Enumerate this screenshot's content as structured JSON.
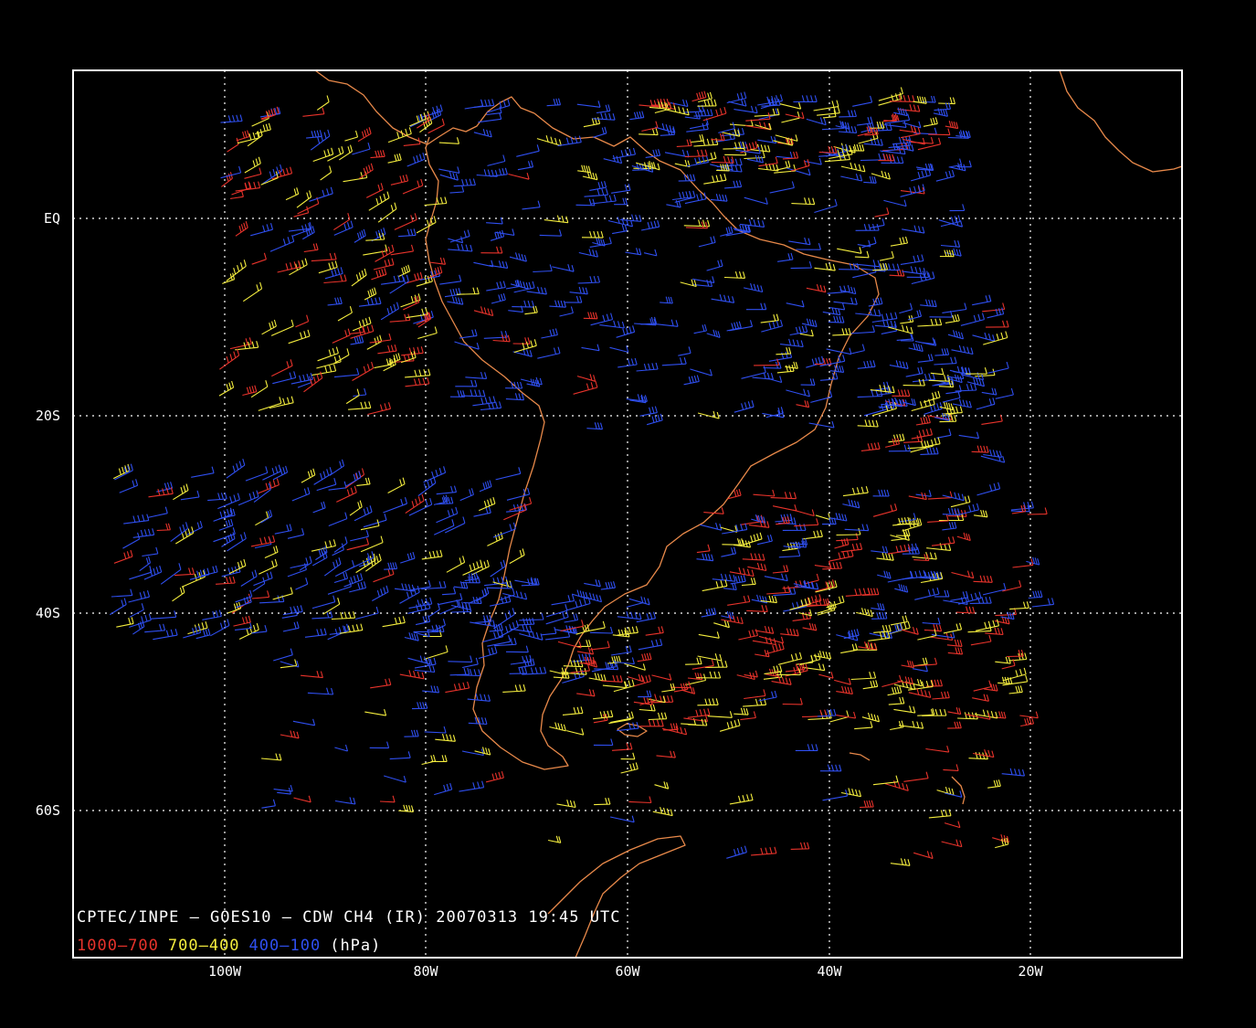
{
  "caption": "CPTEC/INPE — GOES10 — CDW CH4 (IR) 20070313 19:45 UTC",
  "legend": [
    {
      "label": "1000–700",
      "color": "#e8332b"
    },
    {
      "label": "700–400",
      "color": "#f5ee3e"
    },
    {
      "label": "400–100",
      "color": "#2f4ff0"
    },
    {
      "label": "(hPa)",
      "color": "#ffffff"
    }
  ],
  "x_ticks": [
    "100W",
    "80W",
    "60W",
    "40W",
    "20W"
  ],
  "y_ticks": [
    "EQ",
    "20S",
    "40S",
    "60S"
  ],
  "colors": {
    "background": "#000000",
    "frame": "#ffffff",
    "coastline": "#e8894a",
    "low_level": "#e8332b",
    "mid_level": "#f5ee3e",
    "high_level": "#2f4ff0"
  },
  "map": {
    "lon_range": [
      -115,
      -5
    ],
    "lat_range": [
      -75,
      15
    ],
    "projection": "cylindrical equidistant",
    "grid": true
  }
}
